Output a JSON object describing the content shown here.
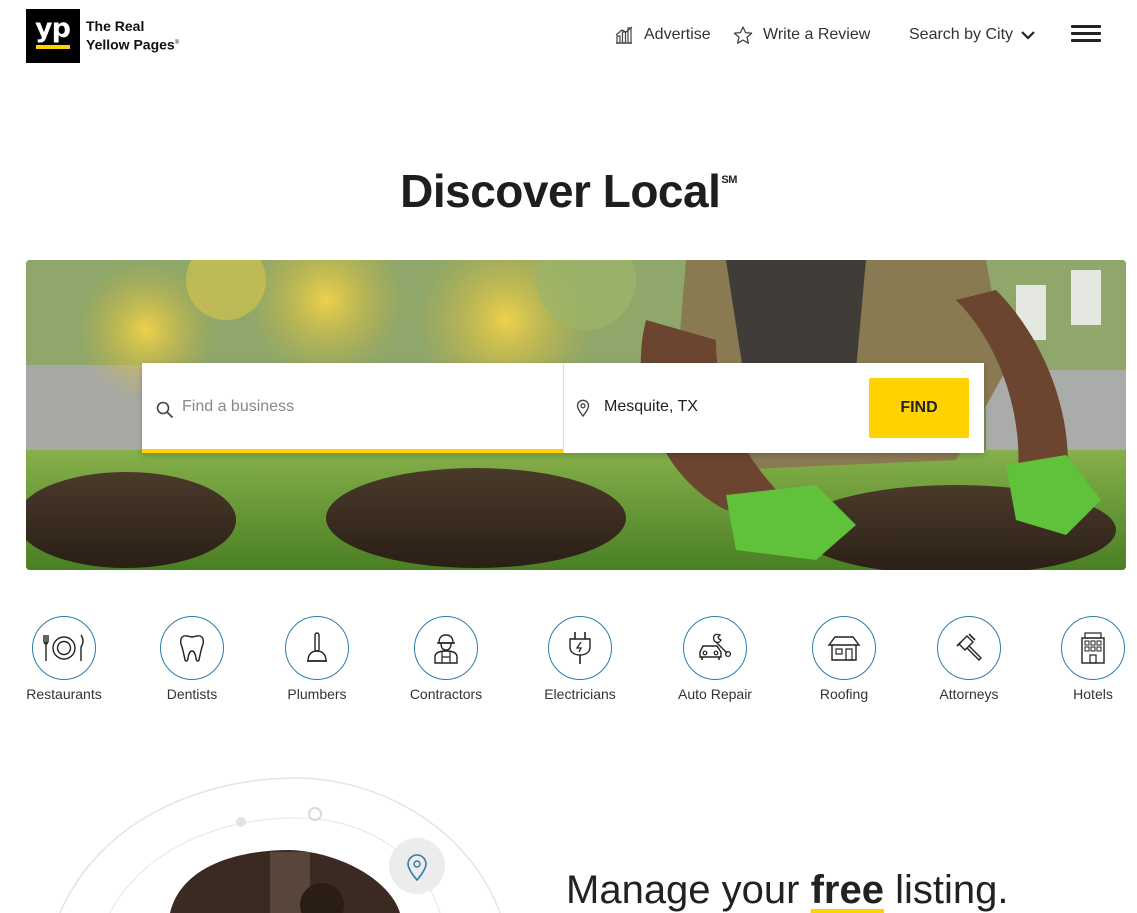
{
  "brand": {
    "logo_mark": "yp",
    "line1": "The Real",
    "line2": "Yellow Pages",
    "reg": "®"
  },
  "nav": {
    "advertise": "Advertise",
    "write_review": "Write a Review",
    "search_by_city": "Search by City"
  },
  "hero": {
    "title": "Discover Local",
    "title_mark": "SM"
  },
  "search": {
    "what_placeholder": "Find a business",
    "where_value": "Mesquite, TX",
    "find_label": "FIND"
  },
  "categories": [
    {
      "label": "Restaurants",
      "icon": "restaurant-icon"
    },
    {
      "label": "Dentists",
      "icon": "tooth-icon"
    },
    {
      "label": "Plumbers",
      "icon": "plunger-icon"
    },
    {
      "label": "Contractors",
      "icon": "worker-icon"
    },
    {
      "label": "Electricians",
      "icon": "plug-icon"
    },
    {
      "label": "Auto Repair",
      "icon": "car-wrench-icon"
    },
    {
      "label": "Roofing",
      "icon": "house-icon"
    },
    {
      "label": "Attorneys",
      "icon": "gavel-icon"
    },
    {
      "label": "Hotels",
      "icon": "hotel-icon"
    }
  ],
  "promo": {
    "pre": "Manage your",
    "bold": "free",
    "post": "listing."
  },
  "colors": {
    "accent_yellow": "#ffd200",
    "icon_blue": "#2f7da8"
  }
}
